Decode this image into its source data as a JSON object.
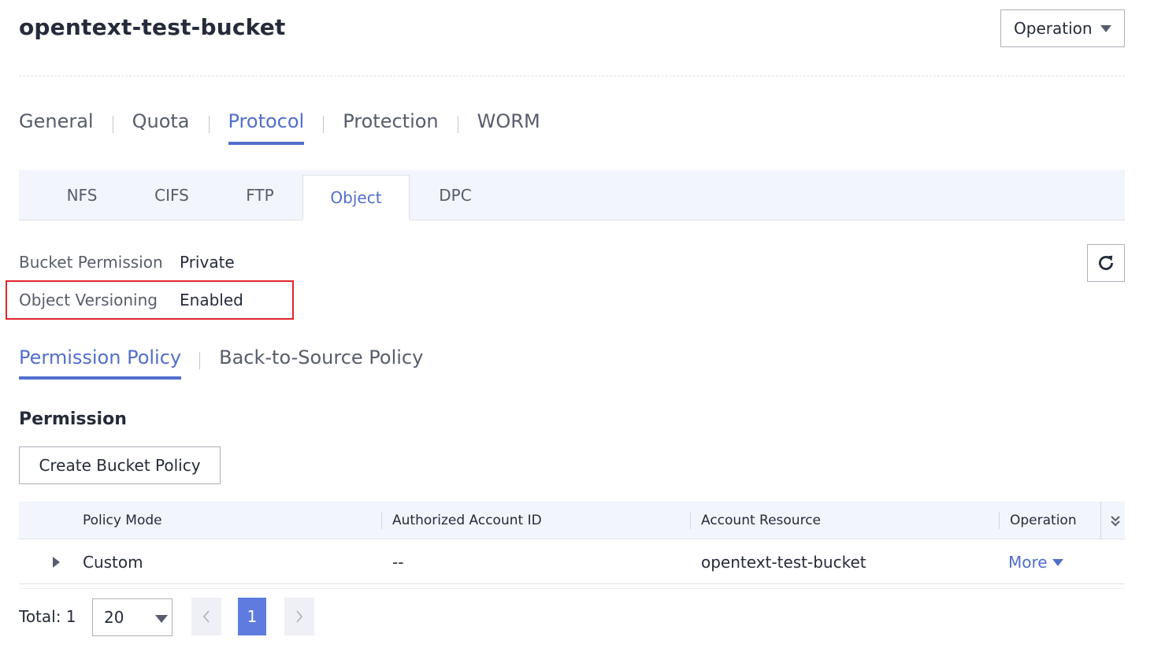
{
  "header": {
    "title": "opentext-test-bucket",
    "operation_label": "Operation"
  },
  "main_tabs": [
    {
      "label": "General",
      "active": false
    },
    {
      "label": "Quota",
      "active": false
    },
    {
      "label": "Protocol",
      "active": true
    },
    {
      "label": "Protection",
      "active": false
    },
    {
      "label": "WORM",
      "active": false
    }
  ],
  "sub_tabs": [
    {
      "label": "NFS",
      "active": false
    },
    {
      "label": "CIFS",
      "active": false
    },
    {
      "label": "FTP",
      "active": false
    },
    {
      "label": "Object",
      "active": true
    },
    {
      "label": "DPC",
      "active": false
    }
  ],
  "properties": {
    "bucket_permission": {
      "label": "Bucket Permission",
      "value": "Private"
    },
    "object_versioning": {
      "label": "Object Versioning",
      "value": "Enabled"
    }
  },
  "policy_tabs": [
    {
      "label": "Permission Policy",
      "active": true
    },
    {
      "label": "Back-to-Source Policy",
      "active": false
    }
  ],
  "permission": {
    "section_title": "Permission",
    "create_button": "Create Bucket Policy",
    "columns": [
      "Policy Mode",
      "Authorized Account ID",
      "Account Resource",
      "Operation"
    ],
    "rows": [
      {
        "policy_mode": "Custom",
        "authorized_account_id": "--",
        "account_resource": "opentext-test-bucket",
        "operation": "More"
      }
    ]
  },
  "pagination": {
    "total_label": "Total: 1",
    "page_size": "20",
    "current_page": "1"
  },
  "icons": {
    "refresh": "refresh-icon",
    "dropdown": "caret-down-icon",
    "expand": "caret-right-icon",
    "column_settings": "double-chevron-down-icon",
    "prev": "chevron-left-icon",
    "next": "chevron-right-icon"
  },
  "colors": {
    "accent": "#526ecc",
    "page_active": "#5e7ce0",
    "highlight_border": "#e0252b",
    "header_bg": "#f2f5fc"
  }
}
